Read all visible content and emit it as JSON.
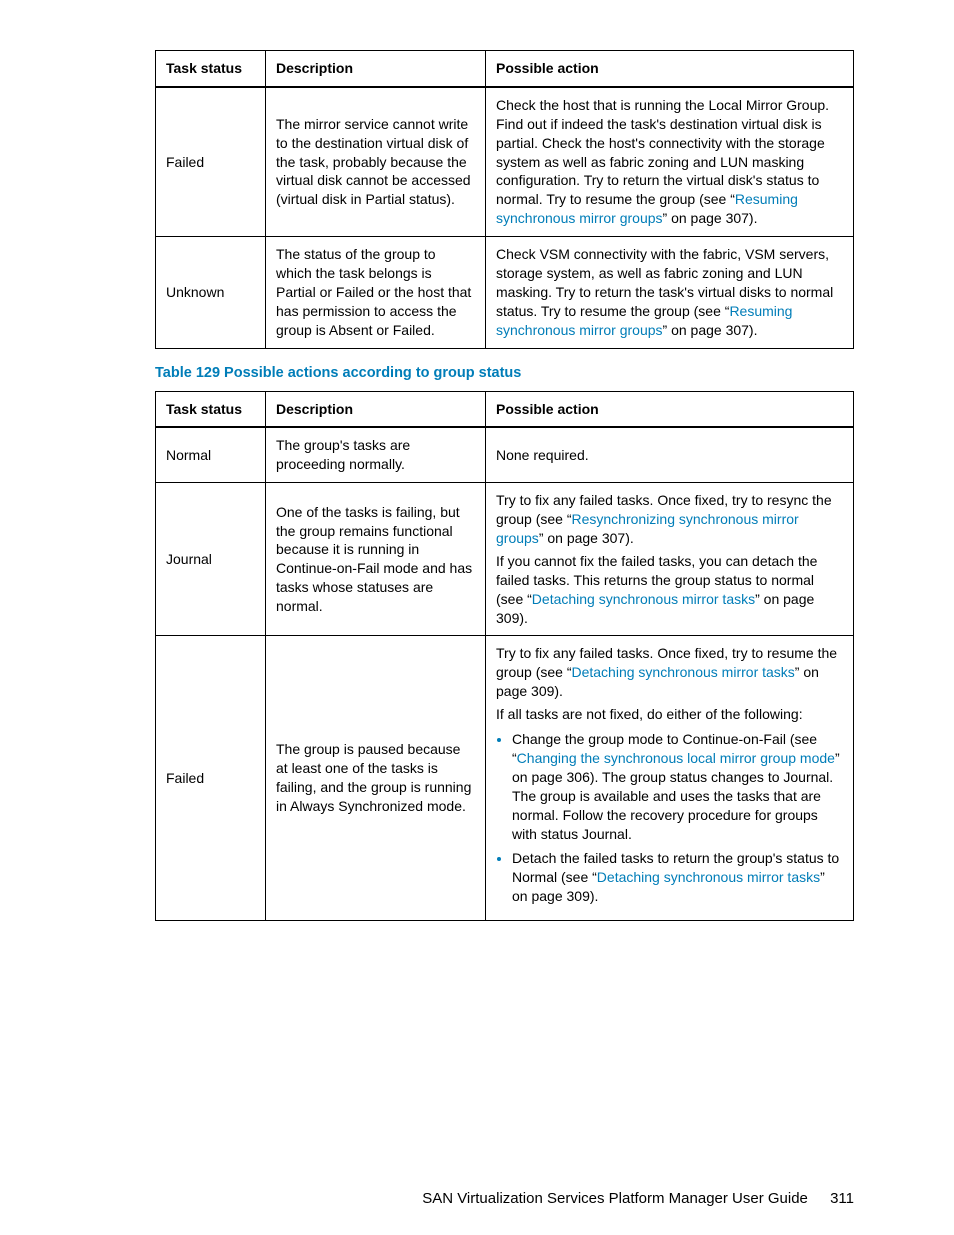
{
  "table1": {
    "headers": {
      "status": "Task status",
      "desc": "Description",
      "action": "Possible action"
    },
    "rows": [
      {
        "status": "Failed",
        "desc": "The mirror service cannot write to the destination virtual disk of the task, probably because the virtual disk cannot be accessed (virtual disk in Partial status).",
        "action_pre": "Check the host that is running the Local Mirror Group. Find out if indeed the task's destination virtual disk is partial. Check the host's connectivity with the storage system as well as fabric zoning and LUN masking configuration. Try to return the virtual disk's status to normal. Try to resume the group (see “",
        "action_link": "Resuming synchronous mirror groups",
        "action_post": "” on page 307)."
      },
      {
        "status": "Unknown",
        "desc": "The status of the group to which the task belongs is Partial or Failed or the host that has permission to access the group is Absent or Failed.",
        "action_pre": "Check VSM connectivity with the fabric, VSM servers, storage system, as well as fabric zoning and LUN masking. Try to return the task's virtual disks to normal status. Try to resume the group (see “",
        "action_link": "Resuming synchronous mirror groups",
        "action_post": "” on page 307)."
      }
    ]
  },
  "caption2": "Table 129 Possible actions according to group status",
  "table2": {
    "headers": {
      "status": "Task status",
      "desc": "Description",
      "action": "Possible action"
    },
    "rows": {
      "normal": {
        "status": "Normal",
        "desc": "The group's tasks are proceeding normally.",
        "action": "None required."
      },
      "journal": {
        "status": "Journal",
        "desc": "One of the tasks is failing, but the group remains functional because it is running in Continue-on-Fail mode and has tasks whose statuses are normal.",
        "p1_pre": "Try to fix any failed tasks. Once fixed, try to resync the group (see “",
        "p1_link": "Resynchronizing synchronous mirror groups",
        "p1_post": "” on page 307).",
        "p2_pre": "If you cannot fix the failed tasks, you can detach the failed tasks. This returns the group status to normal (see “",
        "p2_link": "Detaching synchronous mirror tasks",
        "p2_post": "” on page 309)."
      },
      "failed": {
        "status": "Failed",
        "desc": "The group is paused because at least one of the tasks is failing, and the group is running in Always Synchronized mode.",
        "p1_pre": "Try to fix any failed tasks. Once fixed, try to resume the group (see “",
        "p1_link": "Detaching synchronous mirror tasks",
        "p1_post": "” on page 309).",
        "p2": "If all tasks are not fixed, do either of the following:",
        "b1_pre": "Change the group mode to Continue-on-Fail (see “",
        "b1_link": "Changing the synchronous local mirror group mode",
        "b1_post": "” on page 306). The group status changes to Journal. The group is available and uses the tasks that are normal. Follow the recovery procedure for groups with status Journal.",
        "b2_pre": "Detach the failed tasks to return the group's status to Normal (see “",
        "b2_link": "Detaching synchronous mirror tasks",
        "b2_post": "” on page 309)."
      }
    }
  },
  "footer": {
    "title": "SAN Virtualization Services Platform Manager User Guide",
    "page": "311"
  }
}
